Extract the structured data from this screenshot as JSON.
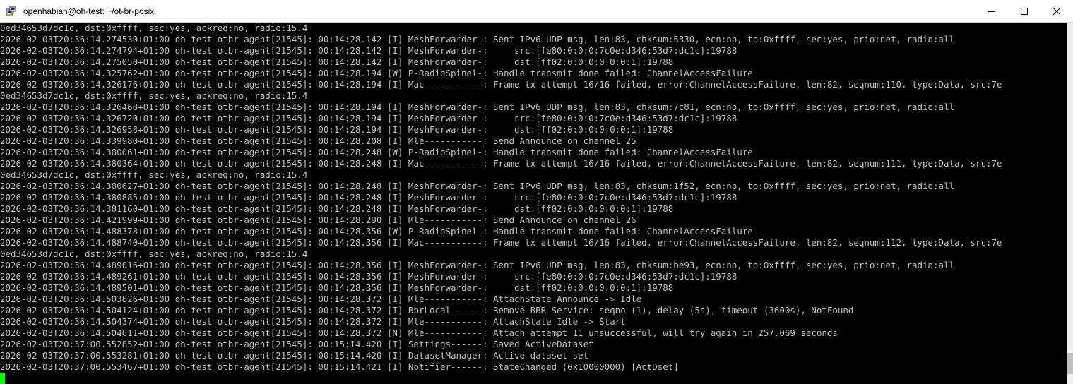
{
  "window": {
    "title": "openhabian@oh-test: ~/ot-br-posix",
    "icon": "putty-icon",
    "controls": [
      "minimize-icon",
      "maximize-icon",
      "close-icon"
    ]
  },
  "terminal": {
    "lines": [
      "0ed34653d7dc1c, dst:0xffff, sec:yes, ackreq:no, radio:15.4",
      "2026-02-03T20:36:14.274530+01:00 oh-test otbr-agent[21545]: 00:14:28.142 [I] MeshForwarder-: Sent IPv6 UDP msg, len:83, chksum:5330, ecn:no, to:0xffff, sec:yes, prio:net, radio:all",
      "2026-02-03T20:36:14.274794+01:00 oh-test otbr-agent[21545]: 00:14:28.142 [I] MeshForwarder-:     src:[fe80:0:0:0:7c0e:d346:53d7:dc1c]:19788",
      "2026-02-03T20:36:14.275050+01:00 oh-test otbr-agent[21545]: 00:14:28.142 [I] MeshForwarder-:     dst:[ff02:0:0:0:0:0:0:1]:19788",
      "2026-02-03T20:36:14.325762+01:00 oh-test otbr-agent[21545]: 00:14:28.194 [W] P-RadioSpinel-: Handle transmit done failed: ChannelAccessFailure",
      "2026-02-03T20:36:14.326176+01:00 oh-test otbr-agent[21545]: 00:14:28.194 [I] Mac-----------: Frame tx attempt 16/16 failed, error:ChannelAccessFailure, len:82, seqnum:110, type:Data, src:7e",
      "0ed34653d7dc1c, dst:0xffff, sec:yes, ackreq:no, radio:15.4",
      "2026-02-03T20:36:14.326468+01:00 oh-test otbr-agent[21545]: 00:14:28.194 [I] MeshForwarder-: Sent IPv6 UDP msg, len:83, chksum:7c81, ecn:no, to:0xffff, sec:yes, prio:net, radio:all",
      "2026-02-03T20:36:14.326720+01:00 oh-test otbr-agent[21545]: 00:14:28.194 [I] MeshForwarder-:     src:[fe80:0:0:0:7c0e:d346:53d7:dc1c]:19788",
      "2026-02-03T20:36:14.326958+01:00 oh-test otbr-agent[21545]: 00:14:28.194 [I] MeshForwarder-:     dst:[ff02:0:0:0:0:0:0:1]:19788",
      "2026-02-03T20:36:14.339980+01:00 oh-test otbr-agent[21545]: 00:14:28.208 [I] Mle-----------: Send Announce on channel 25",
      "2026-02-03T20:36:14.380061+01:00 oh-test otbr-agent[21545]: 00:14:28.248 [W] P-RadioSpinel-: Handle transmit done failed: ChannelAccessFailure",
      "2026-02-03T20:36:14.380364+01:00 oh-test otbr-agent[21545]: 00:14:28.248 [I] Mac-----------: Frame tx attempt 16/16 failed, error:ChannelAccessFailure, len:82, seqnum:111, type:Data, src:7e",
      "0ed34653d7dc1c, dst:0xffff, sec:yes, ackreq:no, radio:15.4",
      "2026-02-03T20:36:14.380627+01:00 oh-test otbr-agent[21545]: 00:14:28.248 [I] MeshForwarder-: Sent IPv6 UDP msg, len:83, chksum:1f52, ecn:no, to:0xffff, sec:yes, prio:net, radio:all",
      "2026-02-03T20:36:14.380885+01:00 oh-test otbr-agent[21545]: 00:14:28.248 [I] MeshForwarder-:     src:[fe80:0:0:0:7c0e:d346:53d7:dc1c]:19788",
      "2026-02-03T20:36:14.381160+01:00 oh-test otbr-agent[21545]: 00:14:28.248 [I] MeshForwarder-:     dst:[ff02:0:0:0:0:0:0:1]:19788",
      "2026-02-03T20:36:14.421999+01:00 oh-test otbr-agent[21545]: 00:14:28.290 [I] Mle-----------: Send Announce on channel 26",
      "2026-02-03T20:36:14.488378+01:00 oh-test otbr-agent[21545]: 00:14:28.356 [W] P-RadioSpinel-: Handle transmit done failed: ChannelAccessFailure",
      "2026-02-03T20:36:14.488740+01:00 oh-test otbr-agent[21545]: 00:14:28.356 [I] Mac-----------: Frame tx attempt 16/16 failed, error:ChannelAccessFailure, len:82, seqnum:112, type:Data, src:7e",
      "0ed34653d7dc1c, dst:0xffff, sec:yes, ackreq:no, radio:15.4",
      "2026-02-03T20:36:14.489016+01:00 oh-test otbr-agent[21545]: 00:14:28.356 [I] MeshForwarder-: Sent IPv6 UDP msg, len:83, chksum:be93, ecn:no, to:0xffff, sec:yes, prio:net, radio:all",
      "2026-02-03T20:36:14.489261+01:00 oh-test otbr-agent[21545]: 00:14:28.356 [I] MeshForwarder-:     src:[fe80:0:0:0:7c0e:d346:53d7:dc1c]:19788",
      "2026-02-03T20:36:14.489501+01:00 oh-test otbr-agent[21545]: 00:14:28.356 [I] MeshForwarder-:     dst:[ff02:0:0:0:0:0:0:1]:19788",
      "2026-02-03T20:36:14.503826+01:00 oh-test otbr-agent[21545]: 00:14:28.372 [I] Mle-----------: AttachState Announce -> Idle",
      "2026-02-03T20:36:14.504124+01:00 oh-test otbr-agent[21545]: 00:14:28.372 [I] BbrLocal------: Remove BBR Service: seqno (1), delay (5s), timeout (3600s), NotFound",
      "2026-02-03T20:36:14.504374+01:00 oh-test otbr-agent[21545]: 00:14:28.372 [I] Mle-----------: AttachState Idle -> Start",
      "2026-02-03T20:36:14.504611+01:00 oh-test otbr-agent[21545]: 00:14:28.372 [N] Mle-----------: Attach attempt 11 unsuccessful, will try again in 257.069 seconds",
      "2026-02-03T20:37:00.552852+01:00 oh-test otbr-agent[21545]: 00:15:14.420 [I] Settings------: Saved ActiveDataset",
      "2026-02-03T20:37:00.553281+01:00 oh-test otbr-agent[21545]: 00:15:14.420 [I] DatasetManager: Active dataset set",
      "2026-02-03T20:37:00.553467+01:00 oh-test otbr-agent[21545]: 00:15:14.421 [I] Notifier------: StateChanged (0x10000000) [ActDset]"
    ]
  },
  "colors": {
    "background": "#000000",
    "text": "#c0c0c0",
    "cursor": "#00ff00",
    "titlebar": "#ffffff"
  }
}
